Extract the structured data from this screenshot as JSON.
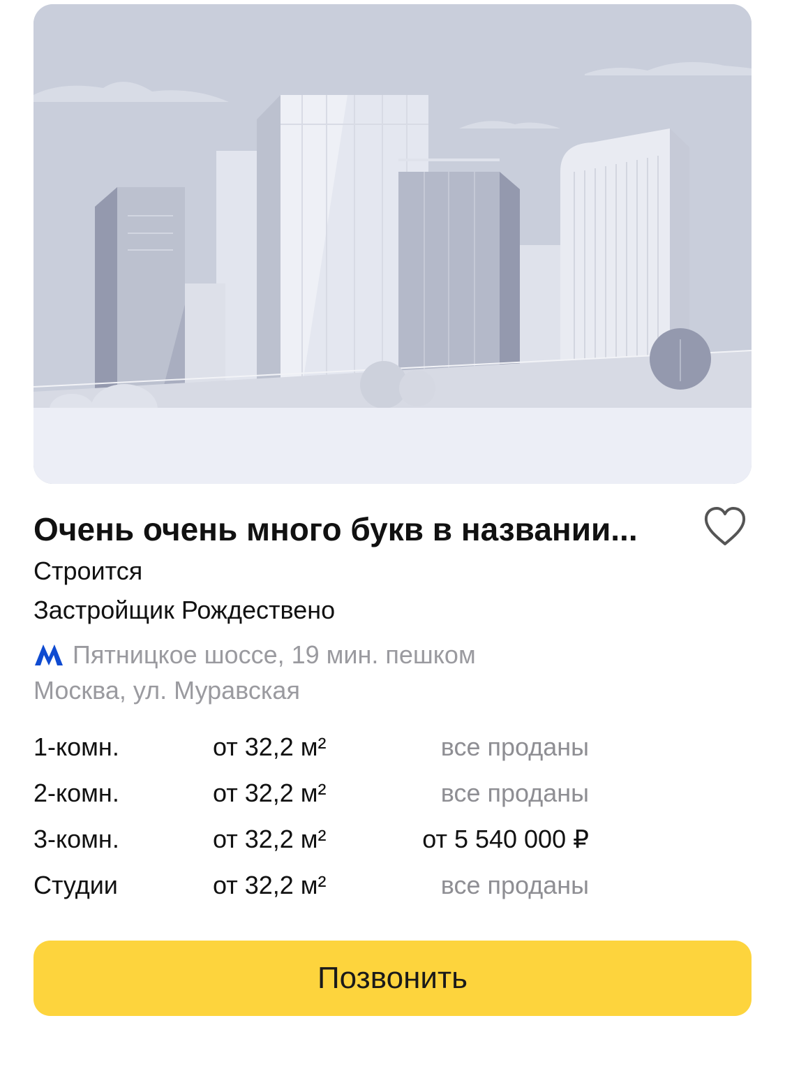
{
  "listing": {
    "title": "Очень очень много букв в названии...",
    "status": "Строится",
    "developer": "Застройщик Рождествено",
    "metro": {
      "icon": "metro-m-icon",
      "text": "Пятницкое шоссе, 19 мин. пешком",
      "color": "#0f4bd1"
    },
    "address": "Москва, ул. Муравская",
    "favorite_icon": "heart-outline-icon"
  },
  "rooms": [
    {
      "type": "1-комн.",
      "area": "от 32,2 м²",
      "price": "все проданы",
      "sold": true
    },
    {
      "type": "2-комн.",
      "area": "от 32,2 м²",
      "price": "все проданы",
      "sold": true
    },
    {
      "type": "3-комн.",
      "area": "от 32,2 м²",
      "price": "от 5 540 000 ₽",
      "sold": false
    },
    {
      "type": "Студии",
      "area": "от 32,2 м²",
      "price": "все проданы",
      "sold": true
    }
  ],
  "actions": {
    "call_label": "Позвонить",
    "call_color": "#fdd43d"
  }
}
